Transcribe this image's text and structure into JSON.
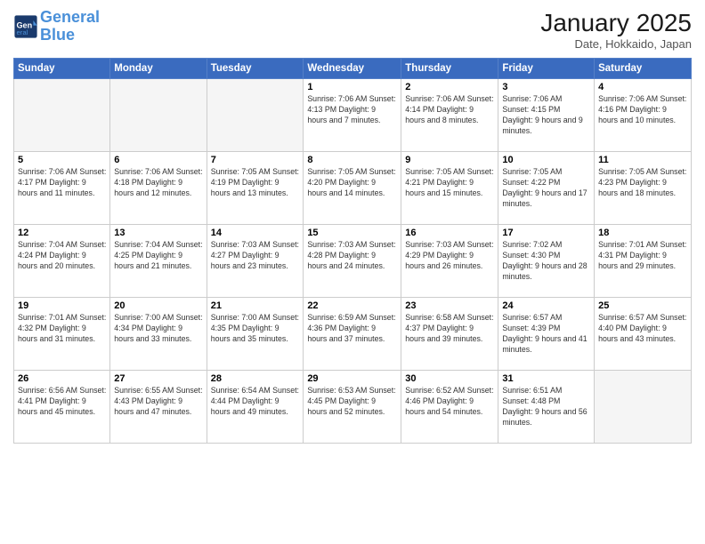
{
  "logo": {
    "line1": "General",
    "line2": "Blue"
  },
  "title": "January 2025",
  "subtitle": "Date, Hokkaido, Japan",
  "weekdays": [
    "Sunday",
    "Monday",
    "Tuesday",
    "Wednesday",
    "Thursday",
    "Friday",
    "Saturday"
  ],
  "weeks": [
    [
      {
        "day": "",
        "info": ""
      },
      {
        "day": "",
        "info": ""
      },
      {
        "day": "",
        "info": ""
      },
      {
        "day": "1",
        "info": "Sunrise: 7:06 AM\nSunset: 4:13 PM\nDaylight: 9 hours\nand 7 minutes."
      },
      {
        "day": "2",
        "info": "Sunrise: 7:06 AM\nSunset: 4:14 PM\nDaylight: 9 hours\nand 8 minutes."
      },
      {
        "day": "3",
        "info": "Sunrise: 7:06 AM\nSunset: 4:15 PM\nDaylight: 9 hours\nand 9 minutes."
      },
      {
        "day": "4",
        "info": "Sunrise: 7:06 AM\nSunset: 4:16 PM\nDaylight: 9 hours\nand 10 minutes."
      }
    ],
    [
      {
        "day": "5",
        "info": "Sunrise: 7:06 AM\nSunset: 4:17 PM\nDaylight: 9 hours\nand 11 minutes."
      },
      {
        "day": "6",
        "info": "Sunrise: 7:06 AM\nSunset: 4:18 PM\nDaylight: 9 hours\nand 12 minutes."
      },
      {
        "day": "7",
        "info": "Sunrise: 7:05 AM\nSunset: 4:19 PM\nDaylight: 9 hours\nand 13 minutes."
      },
      {
        "day": "8",
        "info": "Sunrise: 7:05 AM\nSunset: 4:20 PM\nDaylight: 9 hours\nand 14 minutes."
      },
      {
        "day": "9",
        "info": "Sunrise: 7:05 AM\nSunset: 4:21 PM\nDaylight: 9 hours\nand 15 minutes."
      },
      {
        "day": "10",
        "info": "Sunrise: 7:05 AM\nSunset: 4:22 PM\nDaylight: 9 hours\nand 17 minutes."
      },
      {
        "day": "11",
        "info": "Sunrise: 7:05 AM\nSunset: 4:23 PM\nDaylight: 9 hours\nand 18 minutes."
      }
    ],
    [
      {
        "day": "12",
        "info": "Sunrise: 7:04 AM\nSunset: 4:24 PM\nDaylight: 9 hours\nand 20 minutes."
      },
      {
        "day": "13",
        "info": "Sunrise: 7:04 AM\nSunset: 4:25 PM\nDaylight: 9 hours\nand 21 minutes."
      },
      {
        "day": "14",
        "info": "Sunrise: 7:03 AM\nSunset: 4:27 PM\nDaylight: 9 hours\nand 23 minutes."
      },
      {
        "day": "15",
        "info": "Sunrise: 7:03 AM\nSunset: 4:28 PM\nDaylight: 9 hours\nand 24 minutes."
      },
      {
        "day": "16",
        "info": "Sunrise: 7:03 AM\nSunset: 4:29 PM\nDaylight: 9 hours\nand 26 minutes."
      },
      {
        "day": "17",
        "info": "Sunrise: 7:02 AM\nSunset: 4:30 PM\nDaylight: 9 hours\nand 28 minutes."
      },
      {
        "day": "18",
        "info": "Sunrise: 7:01 AM\nSunset: 4:31 PM\nDaylight: 9 hours\nand 29 minutes."
      }
    ],
    [
      {
        "day": "19",
        "info": "Sunrise: 7:01 AM\nSunset: 4:32 PM\nDaylight: 9 hours\nand 31 minutes."
      },
      {
        "day": "20",
        "info": "Sunrise: 7:00 AM\nSunset: 4:34 PM\nDaylight: 9 hours\nand 33 minutes."
      },
      {
        "day": "21",
        "info": "Sunrise: 7:00 AM\nSunset: 4:35 PM\nDaylight: 9 hours\nand 35 minutes."
      },
      {
        "day": "22",
        "info": "Sunrise: 6:59 AM\nSunset: 4:36 PM\nDaylight: 9 hours\nand 37 minutes."
      },
      {
        "day": "23",
        "info": "Sunrise: 6:58 AM\nSunset: 4:37 PM\nDaylight: 9 hours\nand 39 minutes."
      },
      {
        "day": "24",
        "info": "Sunrise: 6:57 AM\nSunset: 4:39 PM\nDaylight: 9 hours\nand 41 minutes."
      },
      {
        "day": "25",
        "info": "Sunrise: 6:57 AM\nSunset: 4:40 PM\nDaylight: 9 hours\nand 43 minutes."
      }
    ],
    [
      {
        "day": "26",
        "info": "Sunrise: 6:56 AM\nSunset: 4:41 PM\nDaylight: 9 hours\nand 45 minutes."
      },
      {
        "day": "27",
        "info": "Sunrise: 6:55 AM\nSunset: 4:43 PM\nDaylight: 9 hours\nand 47 minutes."
      },
      {
        "day": "28",
        "info": "Sunrise: 6:54 AM\nSunset: 4:44 PM\nDaylight: 9 hours\nand 49 minutes."
      },
      {
        "day": "29",
        "info": "Sunrise: 6:53 AM\nSunset: 4:45 PM\nDaylight: 9 hours\nand 52 minutes."
      },
      {
        "day": "30",
        "info": "Sunrise: 6:52 AM\nSunset: 4:46 PM\nDaylight: 9 hours\nand 54 minutes."
      },
      {
        "day": "31",
        "info": "Sunrise: 6:51 AM\nSunset: 4:48 PM\nDaylight: 9 hours\nand 56 minutes."
      },
      {
        "day": "",
        "info": ""
      }
    ]
  ]
}
